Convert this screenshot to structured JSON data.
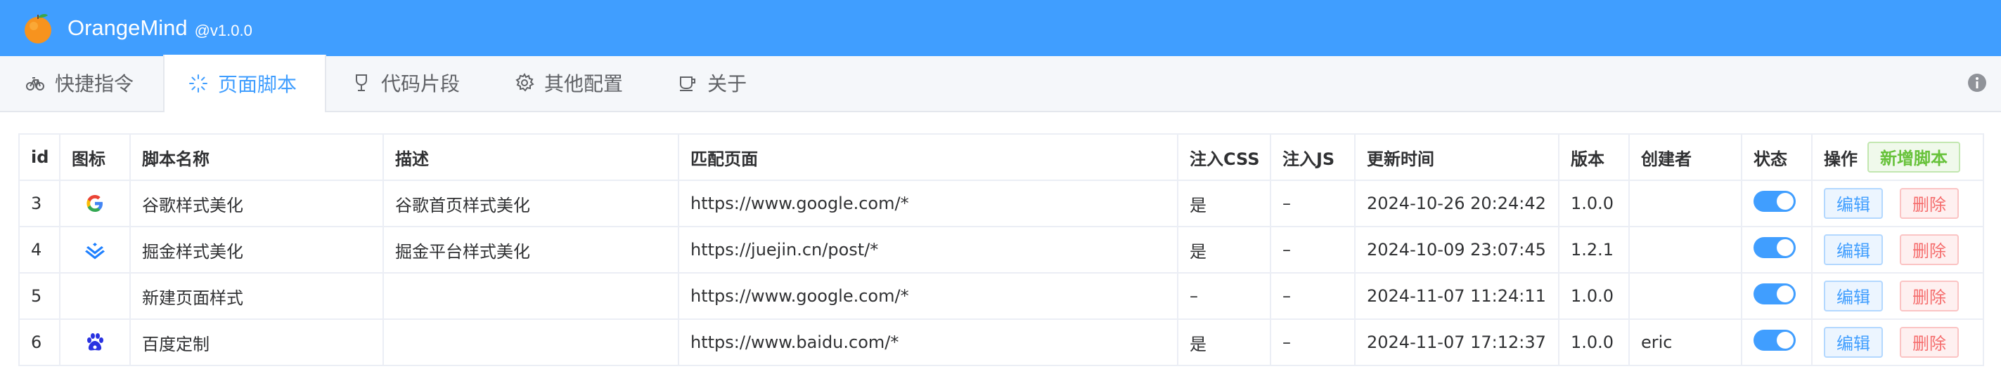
{
  "app": {
    "title": "OrangeMind",
    "version": "@v1.0.0"
  },
  "tabs": [
    {
      "label": "快捷指令",
      "icon": "bike-icon"
    },
    {
      "label": "页面脚本",
      "icon": "loading-icon",
      "active": true
    },
    {
      "label": "代码片段",
      "icon": "cup-icon"
    },
    {
      "label": "其他配置",
      "icon": "gear-icon"
    },
    {
      "label": "关于",
      "icon": "coffee-icon"
    }
  ],
  "table": {
    "headers": {
      "id": "id",
      "icon": "图标",
      "name": "脚本名称",
      "desc": "描述",
      "match": "匹配页面",
      "css": "注入CSS",
      "js": "注入JS",
      "updated": "更新时间",
      "version": "版本",
      "creator": "创建者",
      "status": "状态",
      "ops": "操作"
    },
    "add_label": "新增脚本",
    "edit_label": "编辑",
    "delete_label": "删除",
    "rows": [
      {
        "id": "3",
        "icon": "google-icon",
        "name": "谷歌样式美化",
        "desc": "谷歌首页样式美化",
        "match": "https://www.google.com/*",
        "css": "是",
        "js": "–",
        "updated": "2024-10-26 20:24:42",
        "version": "1.0.0",
        "creator": "",
        "enabled": true
      },
      {
        "id": "4",
        "icon": "juejin-icon",
        "name": "掘金样式美化",
        "desc": "掘金平台样式美化",
        "match": "https://juejin.cn/post/*",
        "css": "是",
        "js": "–",
        "updated": "2024-10-09 23:07:45",
        "version": "1.2.1",
        "creator": "",
        "enabled": true
      },
      {
        "id": "5",
        "icon": "",
        "name": "新建页面样式",
        "desc": "",
        "match": "https://www.google.com/*",
        "css": "–",
        "js": "–",
        "updated": "2024-11-07 11:24:11",
        "version": "1.0.0",
        "creator": "",
        "enabled": true
      },
      {
        "id": "6",
        "icon": "baidu-icon",
        "name": "百度定制",
        "desc": "",
        "match": "https://www.baidu.com/*",
        "css": "是",
        "js": "–",
        "updated": "2024-11-07 17:12:37",
        "version": "1.0.0",
        "creator": "eric",
        "enabled": true
      }
    ]
  },
  "colors": {
    "primary": "#409eff",
    "success": "#67c23a",
    "danger": "#f56c6c"
  }
}
